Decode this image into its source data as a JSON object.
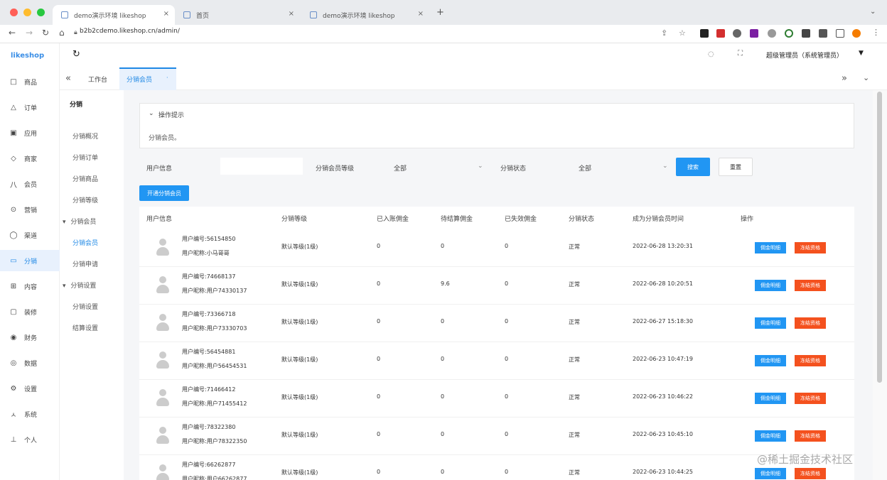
{
  "browser": {
    "tabs": [
      "demo演示环境 likeshop",
      "首页",
      "demo演示环境 likeshop"
    ],
    "url": "b2b2cdemo.likeshop.cn/admin/"
  },
  "app": {
    "logo": "likeshop",
    "user": "超级管理员（系统管理员）"
  },
  "sidebar": [
    {
      "icon": "□",
      "label": "商品"
    },
    {
      "icon": "△",
      "label": "订单"
    },
    {
      "icon": "▣",
      "label": "应用"
    },
    {
      "icon": "◇",
      "label": "商家"
    },
    {
      "icon": "八",
      "label": "会员"
    },
    {
      "icon": "⊙",
      "label": "营销"
    },
    {
      "icon": "◯",
      "label": "渠道"
    },
    {
      "icon": "▭",
      "label": "分销",
      "active": true
    },
    {
      "icon": "⊞",
      "label": "内容"
    },
    {
      "icon": "▢",
      "label": "装修"
    },
    {
      "icon": "◉",
      "label": "财务"
    },
    {
      "icon": "◎",
      "label": "数据"
    },
    {
      "icon": "⚙",
      "label": "设置"
    },
    {
      "icon": "ㅅ",
      "label": "系统"
    },
    {
      "icon": "⊥",
      "label": "个人"
    }
  ],
  "tabs": {
    "workbench": "工作台",
    "current": "分销会员"
  },
  "submenu": {
    "title": "分销",
    "items": [
      "分销概况",
      "分销订单",
      "分销商品",
      "分销等级",
      "分销会员",
      "分销会员",
      "分销申请",
      "分销设置",
      "分销设置",
      "结算设置"
    ]
  },
  "tips": {
    "title": "操作提示",
    "text": "分销会员。"
  },
  "filters": {
    "user_label": "用户信息",
    "level_label": "分销会员等级",
    "level_value": "全部",
    "status_label": "分销状态",
    "status_value": "全部",
    "search": "搜索",
    "reset": "重置",
    "add": "开通分销会员"
  },
  "columns": [
    "用户信息",
    "分销等级",
    "已入账佣金",
    "待结算佣金",
    "已失效佣金",
    "分销状态",
    "成为分销会员时间",
    "操作"
  ],
  "rows": [
    {
      "no": "用户编号:56154850",
      "nick": "用户昵称:小马哥哥",
      "level": "默认等级(1级)",
      "a": "0",
      "b": "0",
      "c": "0",
      "status": "正常",
      "time": "2022-06-28 13:20:31"
    },
    {
      "no": "用户编号:74668137",
      "nick": "用户昵称:用户74330137",
      "level": "默认等级(1级)",
      "a": "0",
      "b": "9.6",
      "c": "0",
      "status": "正常",
      "time": "2022-06-28 10:20:51"
    },
    {
      "no": "用户编号:73366718",
      "nick": "用户昵称:用户73330703",
      "level": "默认等级(1级)",
      "a": "0",
      "b": "0",
      "c": "0",
      "status": "正常",
      "time": "2022-06-27 15:18:30"
    },
    {
      "no": "用户编号:56454881",
      "nick": "用户昵称:用户56454531",
      "level": "默认等级(1级)",
      "a": "0",
      "b": "0",
      "c": "0",
      "status": "正常",
      "time": "2022-06-23 10:47:19"
    },
    {
      "no": "用户编号:71466412",
      "nick": "用户昵称:用户71455412",
      "level": "默认等级(1级)",
      "a": "0",
      "b": "0",
      "c": "0",
      "status": "正常",
      "time": "2022-06-23 10:46:22"
    },
    {
      "no": "用户编号:78322380",
      "nick": "用户昵称:用户78322350",
      "level": "默认等级(1级)",
      "a": "0",
      "b": "0",
      "c": "0",
      "status": "正常",
      "time": "2022-06-23 10:45:10"
    },
    {
      "no": "用户编号:66262877",
      "nick": "用户昵称:用户66262877",
      "level": "默认等级(1级)",
      "a": "0",
      "b": "0",
      "c": "0",
      "status": "正常",
      "time": "2022-06-23 10:44:25"
    }
  ],
  "actions": {
    "detail": "佣金明细",
    "adjust": "冻结资格"
  },
  "watermark": "@稀土掘金技术社区"
}
